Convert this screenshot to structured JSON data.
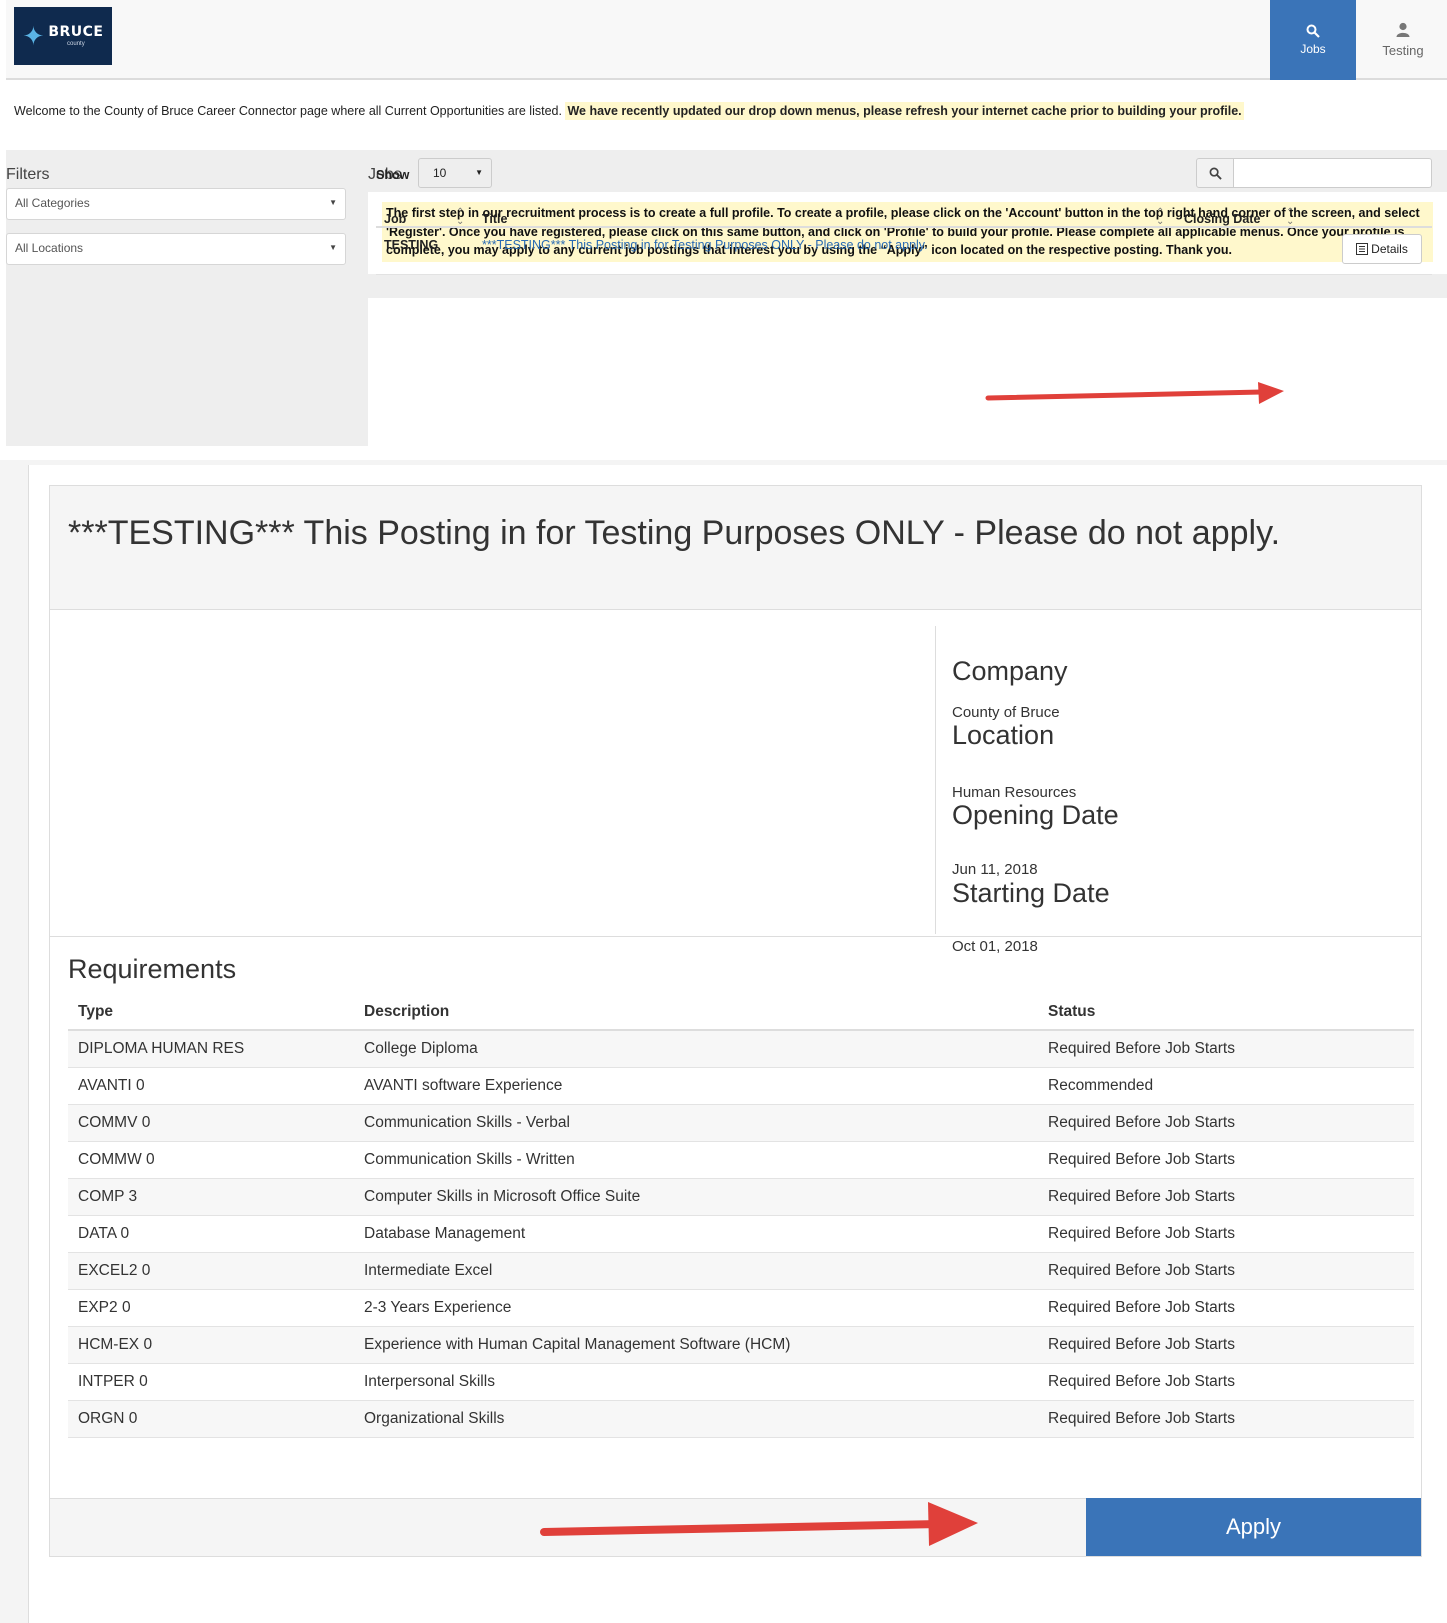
{
  "brand": {
    "logo_text": "BRUCE",
    "logo_sub": "county"
  },
  "nav": {
    "jobs_label": "Jobs",
    "user_label": "Testing"
  },
  "welcome": {
    "text": "Welcome to the County of Bruce Career Connector page where all Current Opportunities are listed.",
    "highlight": "We have recently updated our drop down menus, please refresh your internet cache prior to building your profile."
  },
  "filters": {
    "title": "Filters",
    "category": "All Categories",
    "location": "All Locations"
  },
  "jobs": {
    "title": "Jobs",
    "notice": "The first step in our recruitment process is to create a full profile. To create a profile, please click on the 'Account' button in the top right hand corner of the screen, and select 'Register'. Once you have registered, please click on this same button, and click on 'Profile' to build your profile. Please complete all applicable menus. Once your profile is complete, you may apply to any current job postings that interest you by using the “Apply” icon located on the respective posting. Thank you.",
    "show_label": "Show",
    "show_value": "10",
    "columns": {
      "job": "Job",
      "title": "Title",
      "closing": "Closing Date"
    },
    "row": {
      "job": "TESTING",
      "title": "***TESTING*** This Posting in for Testing Purposes ONLY - Please do not apply.",
      "details": "Details"
    }
  },
  "posting": {
    "title": "***TESTING*** This Posting in for Testing Purposes ONLY - Please do not apply.",
    "company_label": "Company",
    "company": "County of Bruce",
    "location_label": "Location",
    "location": "Human Resources",
    "opening_label": "Opening Date",
    "opening": "Jun 11, 2018",
    "starting_label": "Starting Date",
    "starting": "Oct 01, 2018",
    "requirements_title": "Requirements",
    "req_headers": {
      "type": "Type",
      "description": "Description",
      "status": "Status"
    },
    "requirements": [
      {
        "type": "DIPLOMA HUMAN RES",
        "description": "College Diploma",
        "status": "Required Before Job Starts"
      },
      {
        "type": "AVANTI 0",
        "description": "AVANTI software Experience",
        "status": "Recommended"
      },
      {
        "type": "COMMV 0",
        "description": "Communication Skills - Verbal",
        "status": "Required Before Job Starts"
      },
      {
        "type": "COMMW 0",
        "description": "Communication Skills - Written",
        "status": "Required Before Job Starts"
      },
      {
        "type": "COMP 3",
        "description": "Computer Skills in Microsoft Office Suite",
        "status": "Required Before Job Starts"
      },
      {
        "type": "DATA 0",
        "description": "Database Management",
        "status": "Required Before Job Starts"
      },
      {
        "type": "EXCEL2 0",
        "description": "Intermediate Excel",
        "status": "Required Before Job Starts"
      },
      {
        "type": "EXP2 0",
        "description": "2-3 Years Experience",
        "status": "Required Before Job Starts"
      },
      {
        "type": "HCM-EX 0",
        "description": "Experience with Human Capital Management Software (HCM)",
        "status": "Required Before Job Starts"
      },
      {
        "type": "INTPER 0",
        "description": "Interpersonal Skills",
        "status": "Required Before Job Starts"
      },
      {
        "type": "ORGN 0",
        "description": "Organizational Skills",
        "status": "Required Before Job Starts"
      }
    ],
    "apply_label": "Apply"
  },
  "colors": {
    "primary": "#3a74b8",
    "link": "#2a6bb3",
    "highlight": "#fff8cc",
    "arrow": "#e0403a"
  },
  "icons": {
    "search": "search-icon",
    "user": "user-icon",
    "details": "details-icon",
    "sort": "sort-icon"
  }
}
